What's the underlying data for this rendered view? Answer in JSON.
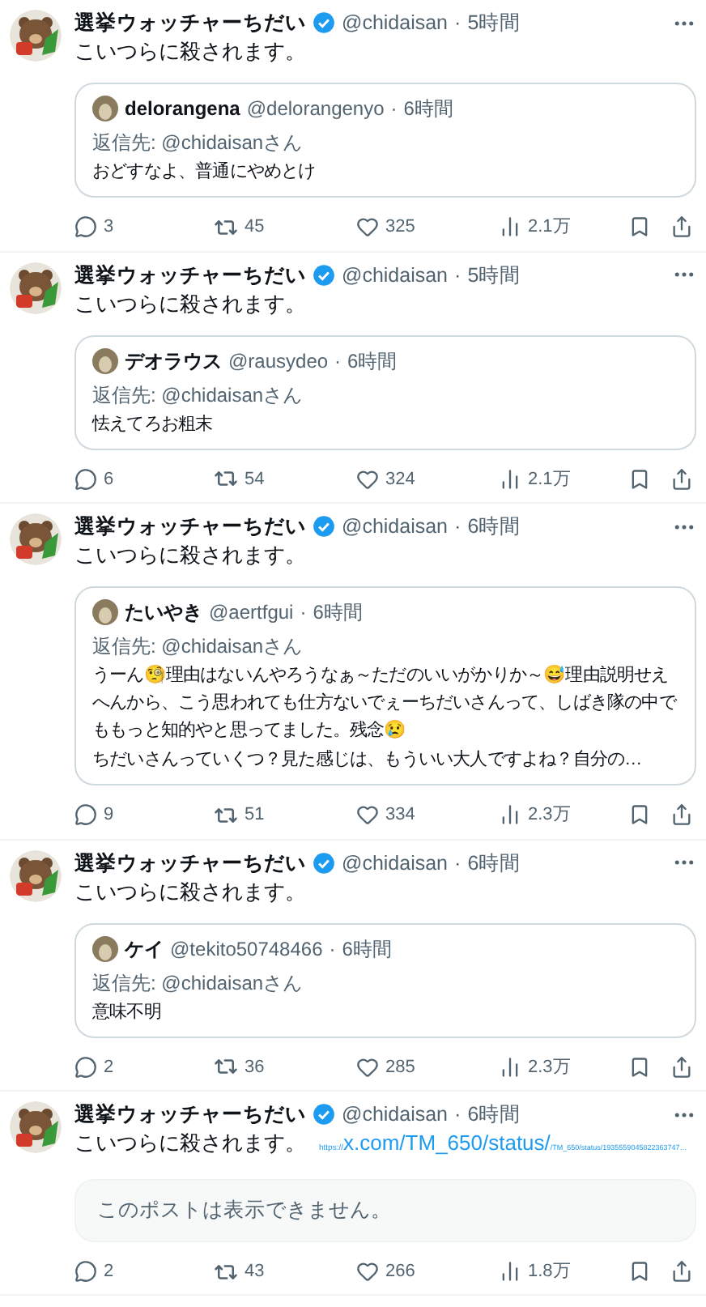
{
  "posts": [
    {
      "author": "選挙ウォッチャーちだい",
      "verified": true,
      "handle": "@chidaisan",
      "separator": "·",
      "time": "5時間",
      "text": "こいつらに殺されます。",
      "quote": {
        "kind": "tweet",
        "author": "delorangena",
        "handle": "@delorangenyo",
        "separator": "·",
        "time": "6時間",
        "reply_to": "返信先: @chidaisanさん",
        "text": [
          "おどすなよ、普通にやめとけ"
        ]
      },
      "replies": "3",
      "reposts": "45",
      "likes": "325",
      "views": "2.1万"
    },
    {
      "author": "選挙ウォッチャーちだい",
      "verified": true,
      "handle": "@chidaisan",
      "separator": "·",
      "time": "5時間",
      "text": "こいつらに殺されます。",
      "quote": {
        "kind": "tweet",
        "author": "デオラウス",
        "handle": "@rausydeo",
        "separator": "·",
        "time": "6時間",
        "reply_to": "返信先: @chidaisanさん",
        "text": [
          "怯えてろお粗末"
        ]
      },
      "replies": "6",
      "reposts": "54",
      "likes": "324",
      "views": "2.1万"
    },
    {
      "author": "選挙ウォッチャーちだい",
      "verified": true,
      "handle": "@chidaisan",
      "separator": "·",
      "time": "6時間",
      "text": "こいつらに殺されます。",
      "quote": {
        "kind": "tweet",
        "author": "たいやき",
        "handle": "@aertfgui",
        "separator": "·",
        "time": "6時間",
        "reply_to": "返信先: @chidaisanさん",
        "text": [
          "うーん🧐理由はないんやろうなぁ～ただのいいがかりか～😅理由説明せえへんから、こう思われても仕方ないでぇーちだいさんって、しばき隊の中でももっと知的やと思ってました。残念😢",
          "ちだいさんっていくつ？見た感じは、もういい大人ですよね？自分の…"
        ]
      },
      "replies": "9",
      "reposts": "51",
      "likes": "334",
      "views": "2.3万"
    },
    {
      "author": "選挙ウォッチャーちだい",
      "verified": true,
      "handle": "@chidaisan",
      "separator": "·",
      "time": "6時間",
      "text": "こいつらに殺されます。",
      "quote": {
        "kind": "tweet",
        "author": "ケイ",
        "handle": "@tekito50748466",
        "separator": "·",
        "time": "6時間",
        "reply_to": "返信先: @chidaisanさん",
        "text": [
          "意味不明"
        ]
      },
      "replies": "2",
      "reposts": "36",
      "likes": "285",
      "views": "2.3万"
    },
    {
      "author": "選挙ウォッチャーちだい",
      "verified": true,
      "handle": "@chidaisan",
      "separator": "·",
      "time": "6時間",
      "text": "こいつらに殺されます。",
      "link": {
        "prefix": "https://",
        "main": "x.com/TM_650/status/",
        "suffix": "/TM_650/status/1935559045822363747…"
      },
      "quote": {
        "kind": "unavailable",
        "text": [
          "このポストは表示できません。"
        ]
      },
      "replies": "2",
      "reposts": "43",
      "likes": "266",
      "views": "1.8万"
    }
  ]
}
